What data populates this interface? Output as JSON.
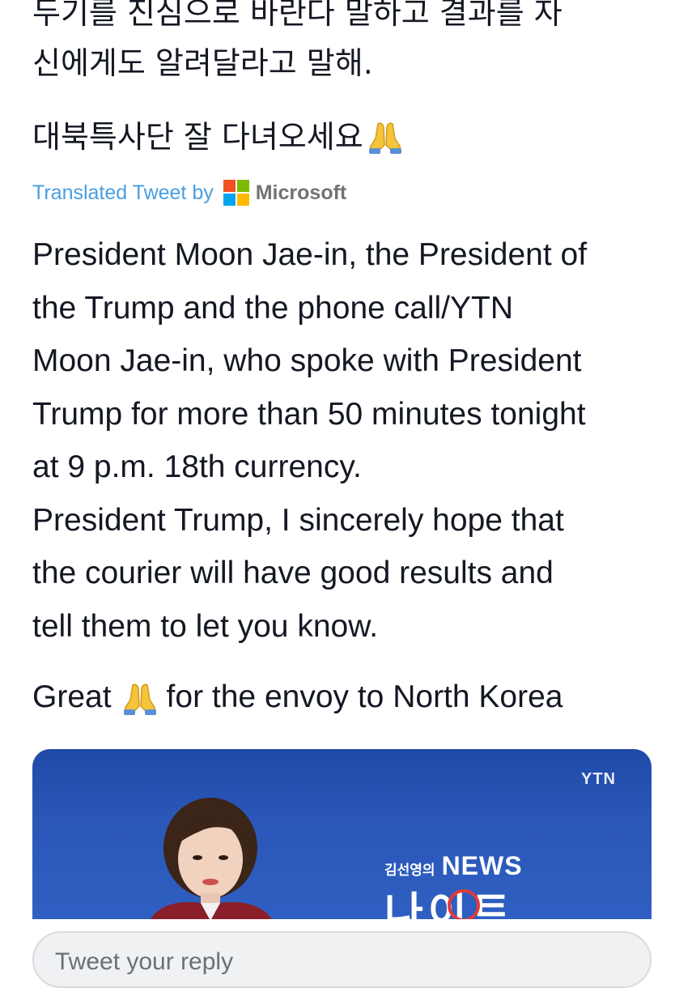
{
  "tweet": {
    "original_lines": [
      "두기를 진심으로 바란다 말하고 결과를 자",
      "신에게도 알려달라고 말해."
    ],
    "original_closing": "대북특사단 잘 다녀오세요",
    "translated_label": "Translated Tweet by",
    "translator_name": "Microsoft",
    "translation_lines": [
      "President Moon Jae-in, the President of",
      "the Trump and the phone call/YTN",
      "Moon Jae-in, who spoke with President",
      "Trump for more than 50 minutes tonight",
      "at 9 p.m. 18th currency.",
      "President Trump, I sincerely hope that",
      "the courier will have good results and",
      "tell them to let you know."
    ],
    "closing_before_emoji": "Great",
    "closing_after_emoji": "for the envoy to North Korea"
  },
  "media": {
    "channel_logo": "YTN",
    "show_host": "김선영의",
    "show_title_en": "NEWS",
    "show_title_ko": "나이트"
  },
  "reply": {
    "placeholder": "Tweet your reply"
  },
  "icons": {
    "folded_hands": "folded-hands-emoji",
    "translator_logo": "microsoft-logo-icon"
  },
  "colors": {
    "link_blue": "#4a9ee0",
    "text": "#141823",
    "media_background": "#2a57b8"
  }
}
